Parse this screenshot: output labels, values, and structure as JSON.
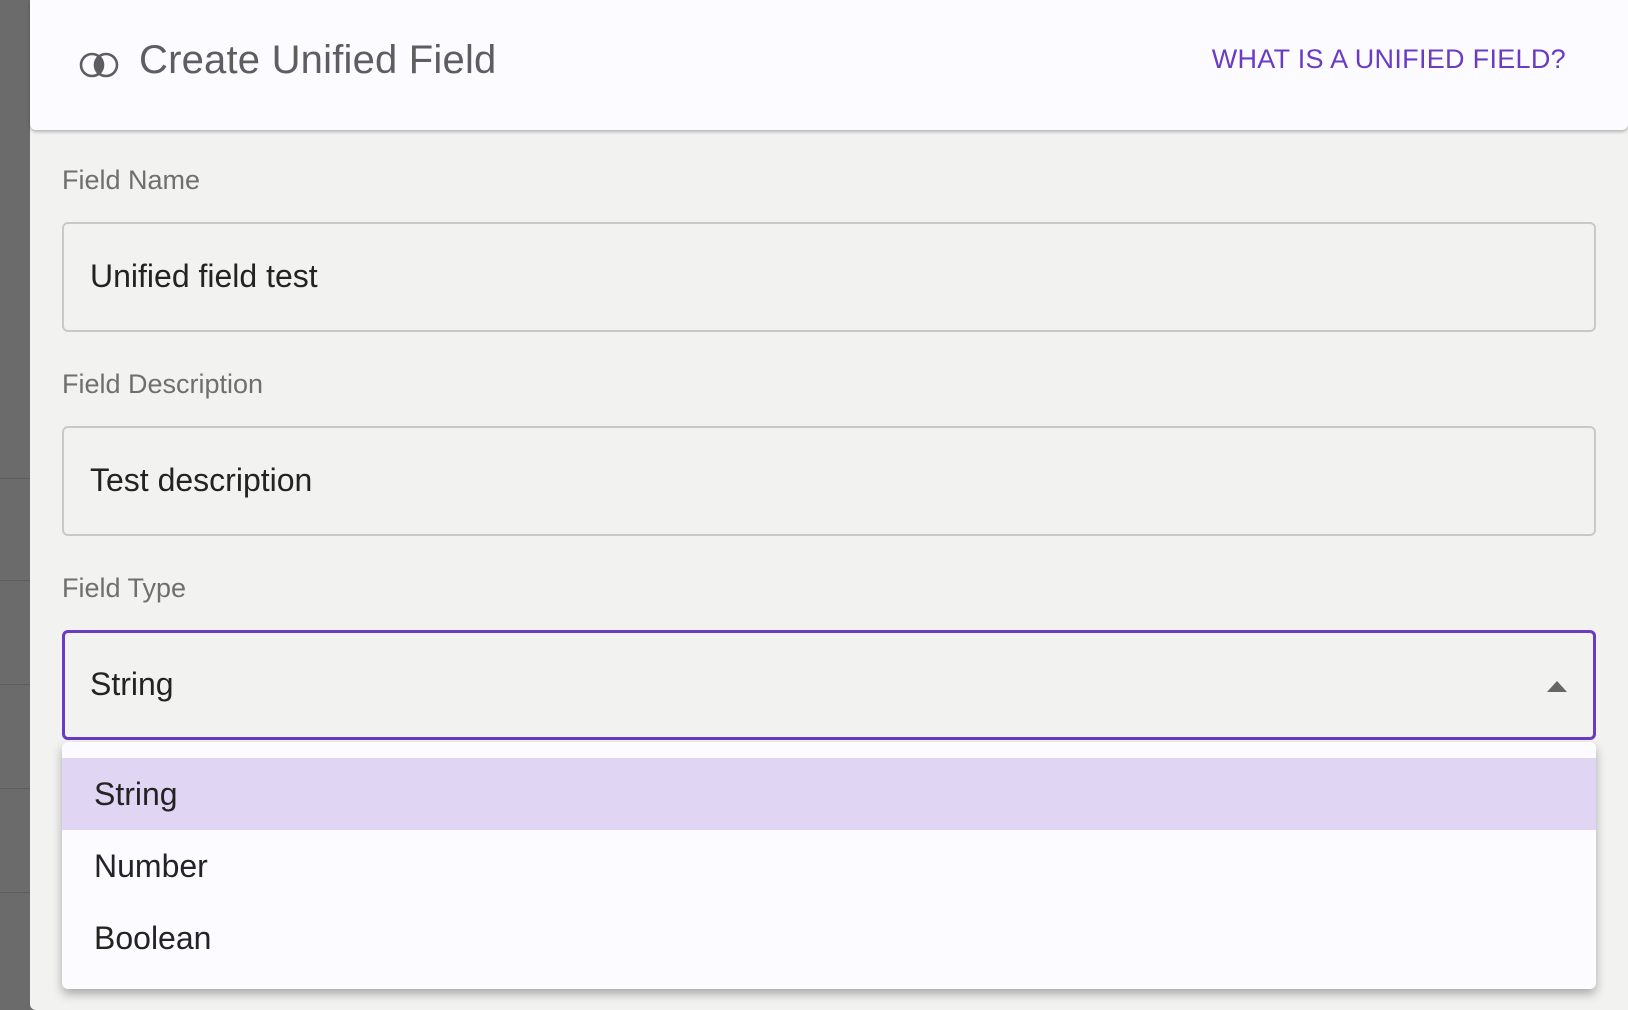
{
  "dialog": {
    "title": "Create Unified Field",
    "help_link": "WHAT IS A UNIFIED FIELD?",
    "accent_color": "#6a3bc4"
  },
  "form": {
    "name": {
      "label": "Field Name",
      "value": "Unified field test"
    },
    "description": {
      "label": "Field Description",
      "value": "Test description"
    },
    "type": {
      "label": "Field Type",
      "value": "String"
    }
  },
  "type_menu": {
    "options": [
      {
        "label": "String",
        "selected": true
      },
      {
        "label": "Number",
        "selected": false
      },
      {
        "label": "Boolean",
        "selected": false
      }
    ],
    "selected_color": "#e0d6f4"
  },
  "icons": {
    "logo": "overlapping-circles-icon",
    "caret": "caret-up-icon"
  }
}
